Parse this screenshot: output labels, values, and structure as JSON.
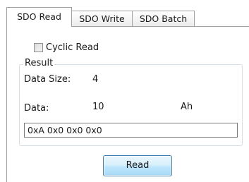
{
  "tabs": [
    {
      "label": "SDO Read",
      "active": true
    },
    {
      "label": "SDO Write",
      "active": false
    },
    {
      "label": "SDO Batch",
      "active": false
    }
  ],
  "cyclic": {
    "label": "Cyclic Read",
    "checked": false
  },
  "result": {
    "title": "Result",
    "data_size_label": "Data Size:",
    "data_size_value": "4",
    "data_label": "Data:",
    "data_value": "10",
    "data_unit": "Ah",
    "raw_value": "0xA 0x0 0x0 0x0"
  },
  "buttons": {
    "read_label": "Read"
  },
  "colors": {
    "button_border": "#3c7fb1",
    "button_fill": "#bee6fd",
    "group_border": "#d5dfe5",
    "tab_border": "#a0a0a0"
  }
}
